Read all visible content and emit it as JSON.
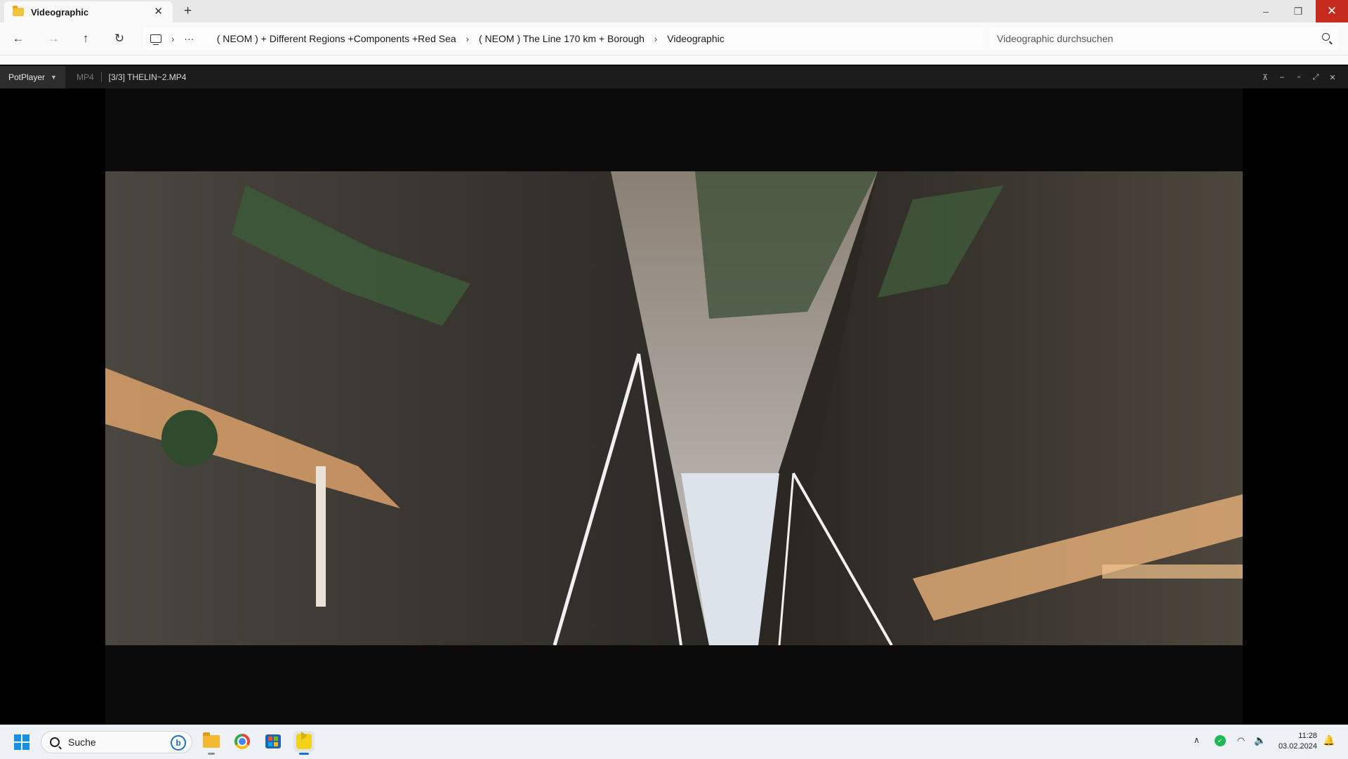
{
  "explorer": {
    "tab_title": "Videographic",
    "new_tab": "+",
    "window_controls": {
      "minimize": "–",
      "maximize": "❐",
      "close": "✕"
    },
    "nav": {
      "back": "←",
      "forward": "→",
      "up": "↑",
      "refresh": "↻"
    },
    "breadcrumbs": [
      "( NEOM ) + Different Regions +Components +Red Sea",
      "( NEOM ) The Line 170 km + Borough",
      "Videographic"
    ],
    "overflow": "···",
    "search_placeholder": "Videographic durchsuchen"
  },
  "player": {
    "brand": "PotPlayer",
    "format": "MP4",
    "title": "[3/3] THELIN~2.MP4",
    "controls": {
      "pin": "⊼",
      "minimize": "‒",
      "maximize": "▫",
      "fullscreen": "⤢",
      "close": "✕"
    }
  },
  "taskbar": {
    "search_label": "Suche",
    "bing_label": "b",
    "time": "11:28",
    "date": "03.02.2024",
    "icons": [
      "windows-start-icon",
      "file-explorer-icon",
      "chrome-icon",
      "store-icon",
      "potplayer-icon",
      "tray-chevron-icon",
      "shield-icon",
      "wifi-icon",
      "volume-icon",
      "notification-bell-icon"
    ]
  },
  "colors": {
    "close_red": "#c42b1c",
    "accent_blue": "#1a6ed8",
    "folder_yellow": "#f5c23b",
    "player_bg": "#000000"
  }
}
